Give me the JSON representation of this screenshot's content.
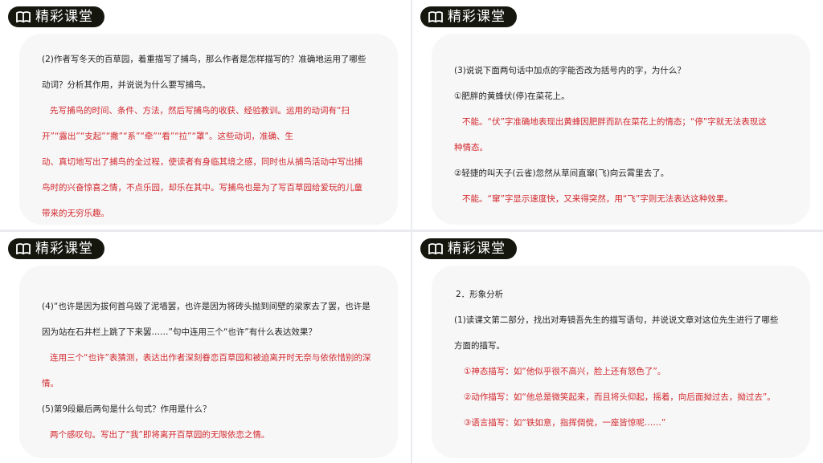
{
  "badge_label": "精彩课堂",
  "slide1": {
    "question": [
      "(2)作者写冬天的百草园，着重描写了捕鸟，那么作者是怎样描写的？准确地运用了哪些",
      "动词？分析其作用，并说说为什么要写捕鸟。"
    ],
    "answer": [
      "先写捕鸟的时间、条件、方法，然后写捕鸟的收获、经验教训。运用的动词有“扫",
      "开”“露出”“支起”“撒”“系”“牵”“看”“拉”“罩”。这些动词，准确、生",
      "动、真切地写出了捕鸟的全过程，使读者有身临其境之感，同时也从捕鸟活动中写出捕",
      "鸟时的兴奋惊喜之情，不点乐园，却乐在其中。写捕鸟也是为了写百草园给爱玩的儿童",
      "带来的无穷乐趣。"
    ]
  },
  "slide2": {
    "question": "(3)说说下面两句话中加点的字能否改为括号内的字，为什么？",
    "item1": "①肥胖的黄蜂伏(停)在菜花上。",
    "answer1": [
      "不能。“伏”字准确地表现出黄蜂因肥胖而趴在菜花上的情态；“停”字就无法表现这",
      "种情态。"
    ],
    "item2": "②轻捷的叫天子(云雀)忽然从草间直窜(飞)向云霄里去了。",
    "answer2": "不能。“窜”字显示速度快，又来得突然，用“飞”字则无法表达这种效果。"
  },
  "slide3": {
    "question4": [
      "(4)“也许是因为拔何首乌毁了泥墙罢，也许是因为将砖头抛到间壁的梁家去了罢，也许是",
      "因为站在石井栏上跳了下来罢……”句中连用三个“也许”有什么表达效果？"
    ],
    "answer4": [
      "连用三个“也许”表猜测，表达出作者深刻眷恋百草园和被迫离开时无奈与依依惜别的深",
      "情。"
    ],
    "question5": "(5)第9段最后两句是什么句式？作用是什么？",
    "answer5": "两个感叹句。写出了“我”即将离开百草园的无限依恋之情。"
  },
  "slide4": {
    "heading": "2．形象分析",
    "question": [
      "(1)读课文第二部分，找出对寿镜吾先生的描写语句，并说说文章对这位先生进行了哪些",
      "方面的描写。"
    ],
    "answers": [
      "①神态描写：如“他似乎很不高兴，脸上还有怒色了”。",
      "②动作描写：如“他总是微笑起来，而且将头仰起，摇着，向后面拗过去，拗过去”。",
      "③语言描写：如“铁如意，指挥倜傥，一座皆惊呢……”"
    ]
  }
}
